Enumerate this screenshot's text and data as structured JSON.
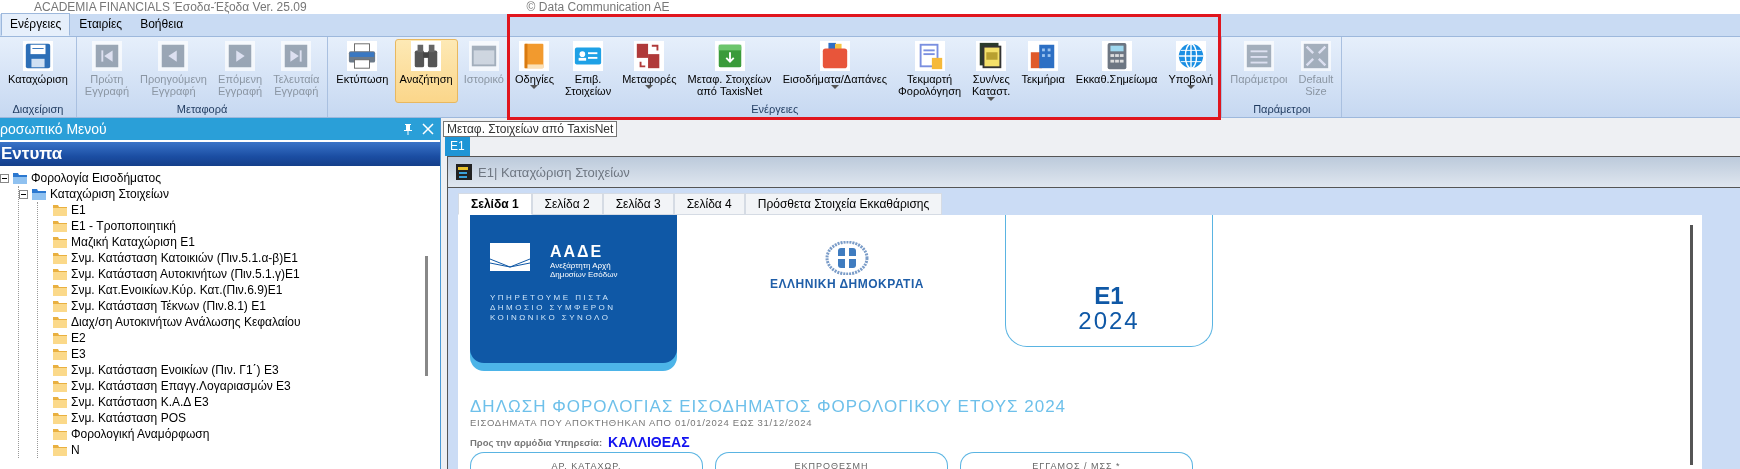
{
  "title_bar": {
    "title": "ACADEMIA FINANCIALS Έσοδα-Έξοδα Ver. 25.09",
    "copyright": "© Data Communication AE"
  },
  "ribbon": {
    "tabs": [
      {
        "label": "Ενέργειες",
        "selected": true
      },
      {
        "label": "Εταιρίες",
        "selected": false
      },
      {
        "label": "Βοήθεια",
        "selected": false
      }
    ],
    "groups": [
      {
        "label": "Διαχείριση",
        "buttons": [
          {
            "label": "Καταχώριση",
            "disabled": false,
            "selected": false,
            "has_menu": false
          }
        ]
      },
      {
        "label": "Μεταφορά",
        "buttons": [
          {
            "label": "Πρώτη\nΕγγραφή",
            "disabled": true,
            "selected": false,
            "has_menu": false
          },
          {
            "label": "Προηγούμενη\nΕγγραφή",
            "disabled": true,
            "selected": false,
            "has_menu": false
          },
          {
            "label": "Επόμενη\nΕγγραφή",
            "disabled": true,
            "selected": false,
            "has_menu": false
          },
          {
            "label": "Τελευταία\nΕγγραφή",
            "disabled": true,
            "selected": false,
            "has_menu": false
          }
        ]
      },
      {
        "label": "Ενέργειες",
        "buttons": [
          {
            "label": "Εκτύπωση",
            "disabled": false,
            "selected": false,
            "has_menu": false
          },
          {
            "label": "Αναζήτηση",
            "disabled": false,
            "selected": true,
            "has_menu": false
          },
          {
            "label": "Ιστορικό",
            "disabled": true,
            "selected": false,
            "has_menu": false
          },
          {
            "label": "Οδηγίες",
            "disabled": false,
            "selected": false,
            "has_menu": true
          },
          {
            "label": "Επιβ.\nΣτοιχείων",
            "disabled": false,
            "selected": false,
            "has_menu": false
          },
          {
            "label": "Μεταφορές",
            "disabled": false,
            "selected": false,
            "has_menu": true
          },
          {
            "label": "Μεταφ. Στοιχείων\nαπό TaxisNet",
            "disabled": false,
            "selected": false,
            "has_menu": false
          },
          {
            "label": "Εισοδήματα/Δαπάνες",
            "disabled": false,
            "selected": false,
            "has_menu": true
          },
          {
            "label": "Τεκμαρτή\nΦορολόγηση",
            "disabled": false,
            "selected": false,
            "has_menu": false
          },
          {
            "label": "Συν/νες\nΚαταστ.",
            "disabled": false,
            "selected": false,
            "has_menu": true
          },
          {
            "label": "Τεκμήρια",
            "disabled": false,
            "selected": false,
            "has_menu": false
          },
          {
            "label": "Εκκαθ.Σημείωμα",
            "disabled": false,
            "selected": false,
            "has_menu": false
          },
          {
            "label": "Υποβολή",
            "disabled": false,
            "selected": false,
            "has_menu": true
          }
        ]
      },
      {
        "label": "Παράμετροι",
        "buttons": [
          {
            "label": "Παράμετροι",
            "disabled": true,
            "selected": false,
            "has_menu": false
          },
          {
            "label": "Default\nSize",
            "disabled": true,
            "selected": false,
            "has_menu": false
          }
        ]
      }
    ]
  },
  "tooltip": "Μεταφ. Στοιχείων από TaxisNet",
  "side_panel": {
    "title": "ροσωπικό Μενού",
    "section": "Εντυπα",
    "tree": [
      {
        "label": "Φορολογία  Εισοδήματος",
        "expanded": true,
        "children": [
          {
            "label": "Καταχώριση Στοιχείων",
            "expanded": true,
            "children": [
              {
                "label": "E1"
              },
              {
                "label": "E1 - Τροποποιητική"
              },
              {
                "label": "Μαζική Καταχώριση E1"
              },
              {
                "label": "Σνμ. Κατάσταση Κατοικιών (Πιν.5.1.α-β)E1"
              },
              {
                "label": "Σνμ. Κατάσταση Αυτοκινήτων (Πιν.5.1.γ)E1"
              },
              {
                "label": "Σνμ. Κατ.Ενοικίων.Κύρ. Κατ.(Πιν.6.9)E1"
              },
              {
                "label": "Σνμ. Κατάσταση Τέκνων (Πιν.8.1) E1"
              },
              {
                "label": "Διαχ/ση Αυτοκινήτων Ανάλωσης Κεφαλαίου"
              },
              {
                "label": "E2"
              },
              {
                "label": "E3"
              },
              {
                "label": "Σνμ. Κατάσταση Ενοικίων (Πιν. Γ1΄) E3"
              },
              {
                "label": "Σνμ. Κατάσταση Επαγγ.Λογαριασμών E3"
              },
              {
                "label": "Σνμ. Κατάσταση Κ.Α.Δ E3"
              },
              {
                "label": "Σνμ. Κατάσταση POS"
              },
              {
                "label": "Φορολογική Αναμόρφωση"
              },
              {
                "label": "N"
              }
            ]
          }
        ]
      }
    ]
  },
  "document_tabs": [
    {
      "label": "E1",
      "selected": true
    }
  ],
  "window": {
    "title": "E1| Καταχώριση Στοιχείων",
    "tabs": [
      {
        "label": "Σελίδα 1",
        "selected": true
      },
      {
        "label": "Σελίδα 2",
        "selected": false
      },
      {
        "label": "Σελίδα 3",
        "selected": false
      },
      {
        "label": "Σελίδα 4",
        "selected": false
      },
      {
        "label": "Πρόσθετα Στοιχεία Εκκαθάρισης",
        "selected": false
      }
    ],
    "form": {
      "logo": {
        "name": "ΑΑΔΕ",
        "subtitle": "Ανεξάρτητη Αρχή\nΔημοσίων Εσόδων",
        "motto": "ΥΠΗΡΕΤΟΥΜΕ ΠΙΣΤΑ\nΔΗΜΟΣΙΟ ΣΥΜΦΕΡΟΝ\nΚΟΙΝΩΝΙΚΟ ΣΥΝΟΛΟ"
      },
      "emblem_caption": "ΕΛΛΗΝΙΚΗ ΔΗΜΟΚΡΑΤΙΑ",
      "form_code": "E1",
      "year": "2024",
      "heading": "ΔΗΛΩΣΗ ΦΟΡΟΛΟΓΙΑΣ ΕΙΣΟΔΗΜΑΤΟΣ ΦΟΡΟΛΟΓΙΚΟΥ ΕΤΟΥΣ 2024",
      "subheading": "ΕΙΣΟΔΗΜΑΤΑ ΠΟΥ ΑΠΟΚΤΗΘΗΚΑΝ ΑΠΟ 01/01/2024 ΕΩΣ 31/12/2024",
      "office_label": "Προς την αρμόδια Υπηρεσία:",
      "office_value": "ΚΑΛΛΙΘΕΑΣ",
      "fields": [
        {
          "label": "ΑΡ. ΚΑΤΑΧΩΡ."
        },
        {
          "label": "ΕΚΠΡΟΘΕΣΜΗ"
        },
        {
          "label": "ΕΓΓΑΜΟΣ / ΜΣΣ *"
        }
      ]
    }
  }
}
